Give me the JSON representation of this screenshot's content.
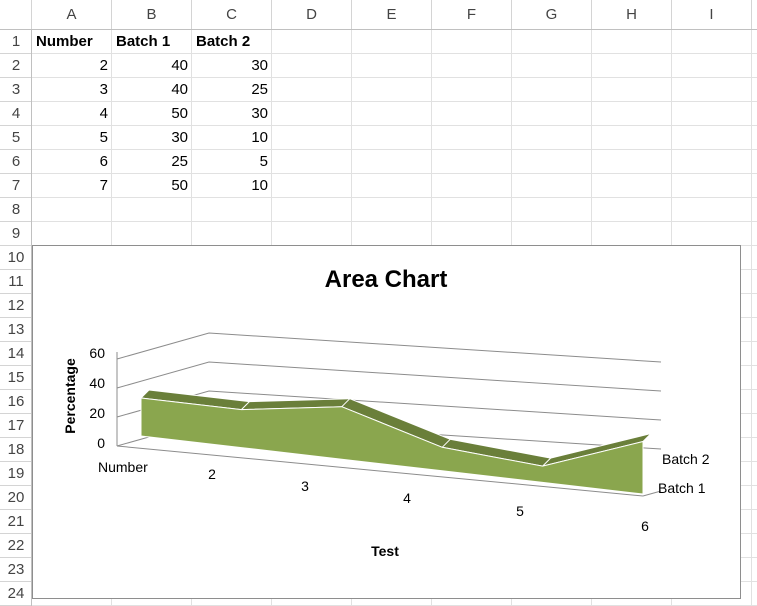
{
  "columns": [
    "A",
    "B",
    "C",
    "D",
    "E",
    "F",
    "G",
    "H",
    "I"
  ],
  "rows": [
    "1",
    "2",
    "3",
    "4",
    "5",
    "6",
    "7",
    "8",
    "9",
    "10",
    "11",
    "12",
    "13",
    "14",
    "15",
    "16",
    "17",
    "18",
    "19",
    "20",
    "21",
    "22",
    "23",
    "24"
  ],
  "sheet": {
    "headers": [
      "Number",
      "Batch 1",
      "Batch 2"
    ],
    "data": [
      [
        "2",
        "40",
        "30"
      ],
      [
        "3",
        "40",
        "25"
      ],
      [
        "4",
        "50",
        "30"
      ],
      [
        "5",
        "30",
        "10"
      ],
      [
        "6",
        "25",
        "5"
      ],
      [
        "7",
        "50",
        "10"
      ]
    ]
  },
  "chart": {
    "title": "Area Chart",
    "xlabel": "Test",
    "ylabel": "Percentage",
    "y_ticks": [
      "0",
      "20",
      "40",
      "60"
    ],
    "x_ticks": [
      "Number",
      "2",
      "3",
      "4",
      "5",
      "6"
    ],
    "series_labels": [
      "Batch 2",
      "Batch 1"
    ]
  },
  "chart_data": {
    "type": "area",
    "title": "Area Chart",
    "xlabel": "Test",
    "ylabel": "Percentage",
    "categories": [
      "Number",
      "2",
      "3",
      "4",
      "5",
      "6"
    ],
    "ylim": [
      0,
      60
    ],
    "grid": true,
    "series": [
      {
        "name": "Batch 1",
        "values": [
          40,
          40,
          50,
          30,
          25,
          50
        ]
      },
      {
        "name": "Batch 2",
        "values": [
          30,
          25,
          30,
          10,
          5,
          10
        ]
      }
    ],
    "colors": {
      "front": "#8aa64e",
      "top": "#6a7f3a"
    }
  }
}
